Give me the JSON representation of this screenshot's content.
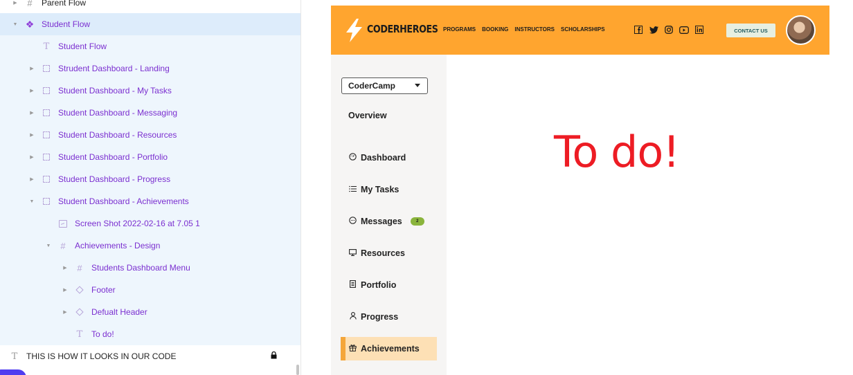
{
  "layers": {
    "items": [
      {
        "label": "Parent Flow",
        "icon": "frame-icon"
      },
      {
        "label": "Student Flow",
        "icon": "component-icon"
      },
      {
        "label": "Student Flow",
        "icon": "text-icon"
      },
      {
        "label": "Strudent Dashboard - Landing",
        "icon": "section-icon"
      },
      {
        "label": "Student Dashboard - My Tasks",
        "icon": "section-icon"
      },
      {
        "label": "Student Dashboard - Messaging",
        "icon": "section-icon"
      },
      {
        "label": "Student Dashboard - Resources",
        "icon": "section-icon"
      },
      {
        "label": "Student Dashboard - Portfolio",
        "icon": "section-icon"
      },
      {
        "label": "Student Dashboard - Progress",
        "icon": "section-icon"
      },
      {
        "label": "Student Dashboard - Achievements",
        "icon": "section-icon"
      },
      {
        "label": "Screen Shot 2022-02-16 at 7.05 1",
        "icon": "image-icon"
      },
      {
        "label": "Achievements - Design",
        "icon": "frame-icon"
      },
      {
        "label": "Students Dashboard Menu",
        "icon": "frame-icon"
      },
      {
        "label": "Footer",
        "icon": "instance-icon"
      },
      {
        "label": "Defualt Header",
        "icon": "instance-icon"
      },
      {
        "label": "To do!",
        "icon": "text-icon"
      },
      {
        "label": "THIS IS HOW IT LOOKS IN OUR CODE",
        "icon": "text-icon"
      }
    ]
  },
  "header": {
    "brand": "CODERHEROES",
    "nav": [
      "PROGRAMS",
      "BOOKING",
      "INSTRUCTORS",
      "SCHOLARSHIPS"
    ],
    "socials": [
      "facebook-icon",
      "twitter-icon",
      "instagram-icon",
      "youtube-icon",
      "linkedin-icon"
    ],
    "contact_label": "CONTACT US",
    "bar_color": "#ffa52f"
  },
  "sidebar": {
    "select_value": "CoderCamp",
    "overview_label": "Overview",
    "items": [
      {
        "label": "Dashboard",
        "icon": "gauge-icon"
      },
      {
        "label": "My Tasks",
        "icon": "list-icon"
      },
      {
        "label": "Messages",
        "icon": "chat-icon",
        "badge": "2"
      },
      {
        "label": "Resources",
        "icon": "monitor-icon"
      },
      {
        "label": "Portfolio",
        "icon": "document-icon"
      },
      {
        "label": "Progress",
        "icon": "person-icon"
      },
      {
        "label": "Achievements",
        "icon": "gift-icon"
      }
    ],
    "active_color": "#fde0b5"
  },
  "main": {
    "placeholder_text": "To do!",
    "placeholder_color": "#ed1c24"
  }
}
